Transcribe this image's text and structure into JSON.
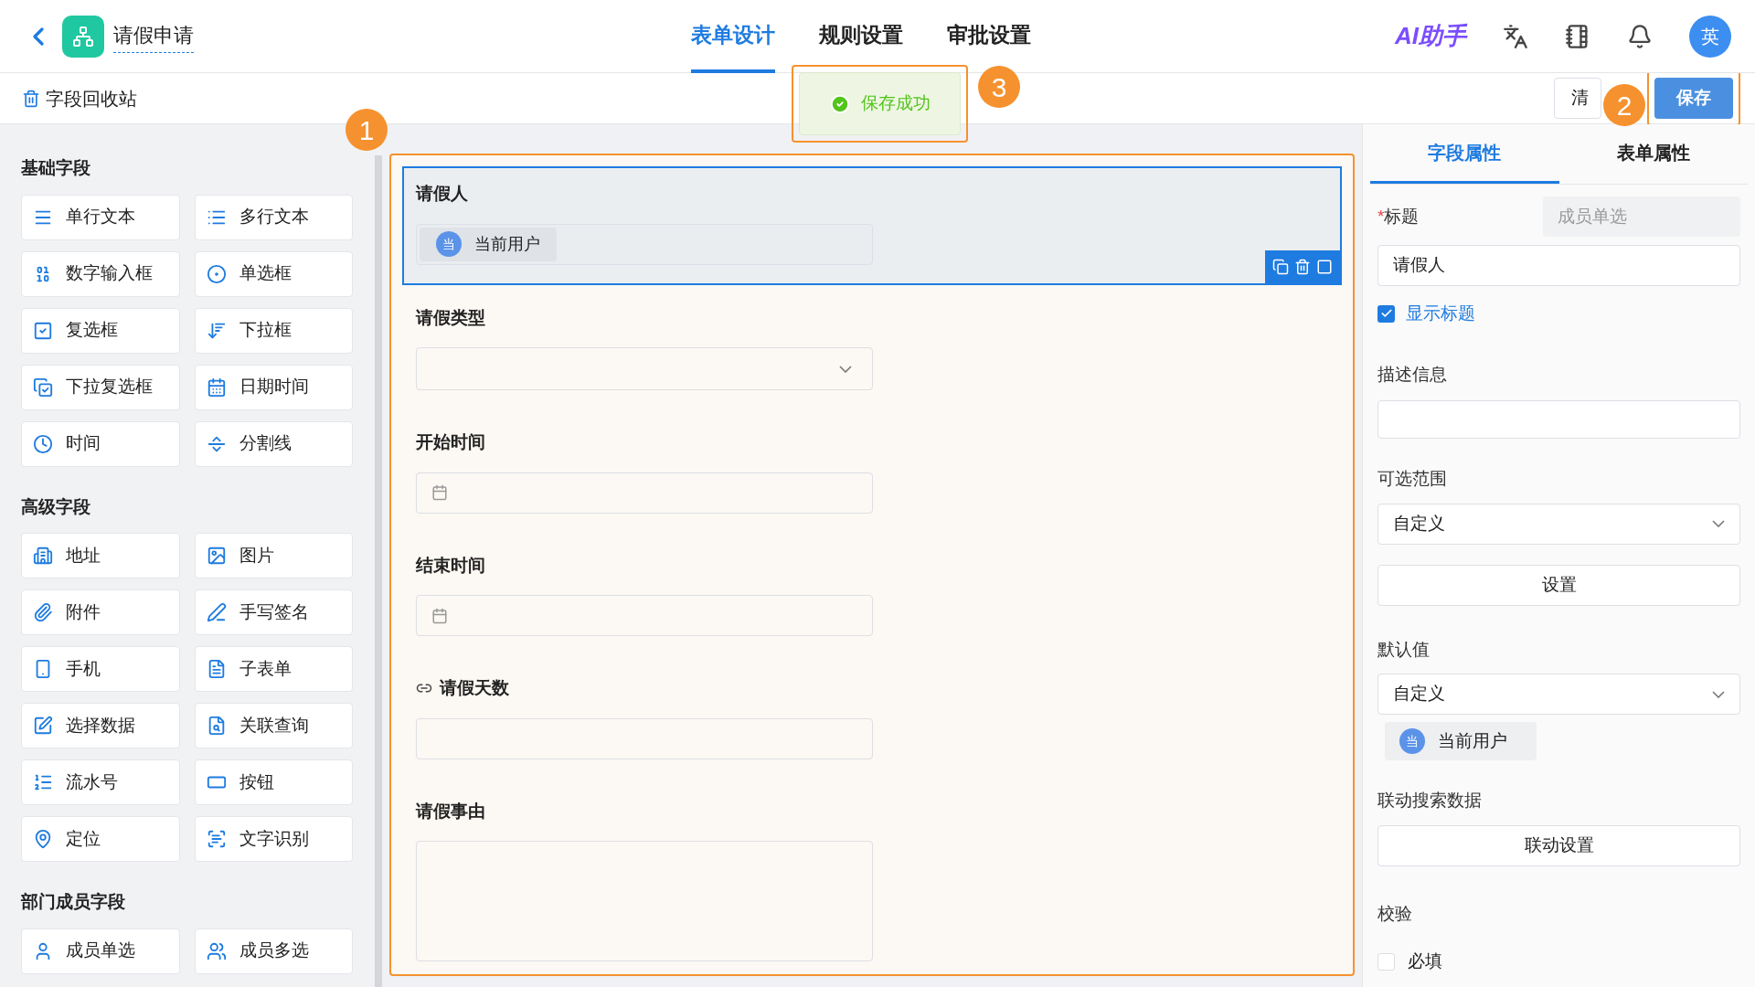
{
  "header": {
    "title": "请假申请",
    "ai_label": "AI助手",
    "avatar": "英",
    "tabs": [
      {
        "label": "表单设计",
        "selected": true
      },
      {
        "label": "规则设置",
        "selected": false
      },
      {
        "label": "审批设置",
        "selected": false
      }
    ]
  },
  "toolbar": {
    "recycle_bin": "字段回收站",
    "buttons": [
      {
        "label": "清",
        "kind": "default"
      },
      {
        "label": "保存",
        "kind": "primary"
      }
    ]
  },
  "toast": {
    "message": "保存成功"
  },
  "callouts": [
    "1",
    "2",
    "3"
  ],
  "palette": {
    "sections": [
      {
        "title": "基础字段",
        "items": [
          "单行文本",
          "多行文本",
          "数字输入框",
          "单选框",
          "复选框",
          "下拉框",
          "下拉复选框",
          "日期时间",
          "时间",
          "分割线"
        ]
      },
      {
        "title": "高级字段",
        "items": [
          "地址",
          "图片",
          "附件",
          "手写签名",
          "手机",
          "子表单",
          "选择数据",
          "关联查询",
          "流水号",
          "按钮",
          "定位",
          "文字识别"
        ]
      },
      {
        "title": "部门成员字段",
        "items": [
          "成员单选",
          "成员多选"
        ]
      }
    ]
  },
  "form": {
    "fields": [
      {
        "label": "请假人",
        "kind": "member",
        "selected": true,
        "linked": false,
        "avatar": "当",
        "value": "当前用户"
      },
      {
        "label": "请假类型",
        "kind": "select",
        "selected": false,
        "linked": false
      },
      {
        "label": "开始时间",
        "kind": "date",
        "selected": false,
        "linked": false
      },
      {
        "label": "结束时间",
        "kind": "date",
        "selected": false,
        "linked": false
      },
      {
        "label": "请假天数",
        "kind": "input",
        "selected": false,
        "linked": true
      },
      {
        "label": "请假事由",
        "kind": "textarea",
        "selected": false,
        "linked": false
      }
    ]
  },
  "properties": {
    "tabs": [
      {
        "label": "字段属性",
        "selected": true
      },
      {
        "label": "表单属性",
        "selected": false
      }
    ],
    "title": {
      "required_mark": "*",
      "label": "标题",
      "type_tag": "成员单选",
      "value": "请假人"
    },
    "show_title": {
      "label": "显示标题",
      "checked": true
    },
    "description": {
      "label": "描述信息"
    },
    "scope": {
      "label": "可选范围",
      "value": "自定义",
      "button": "设置"
    },
    "default": {
      "label": "默认值",
      "value": "自定义",
      "avatar": "当",
      "chip": "当前用户"
    },
    "linkage": {
      "label": "联动搜索数据",
      "button": "联动设置"
    },
    "validation": {
      "label": "校验",
      "option": {
        "label": "必填",
        "checked": false
      }
    }
  }
}
